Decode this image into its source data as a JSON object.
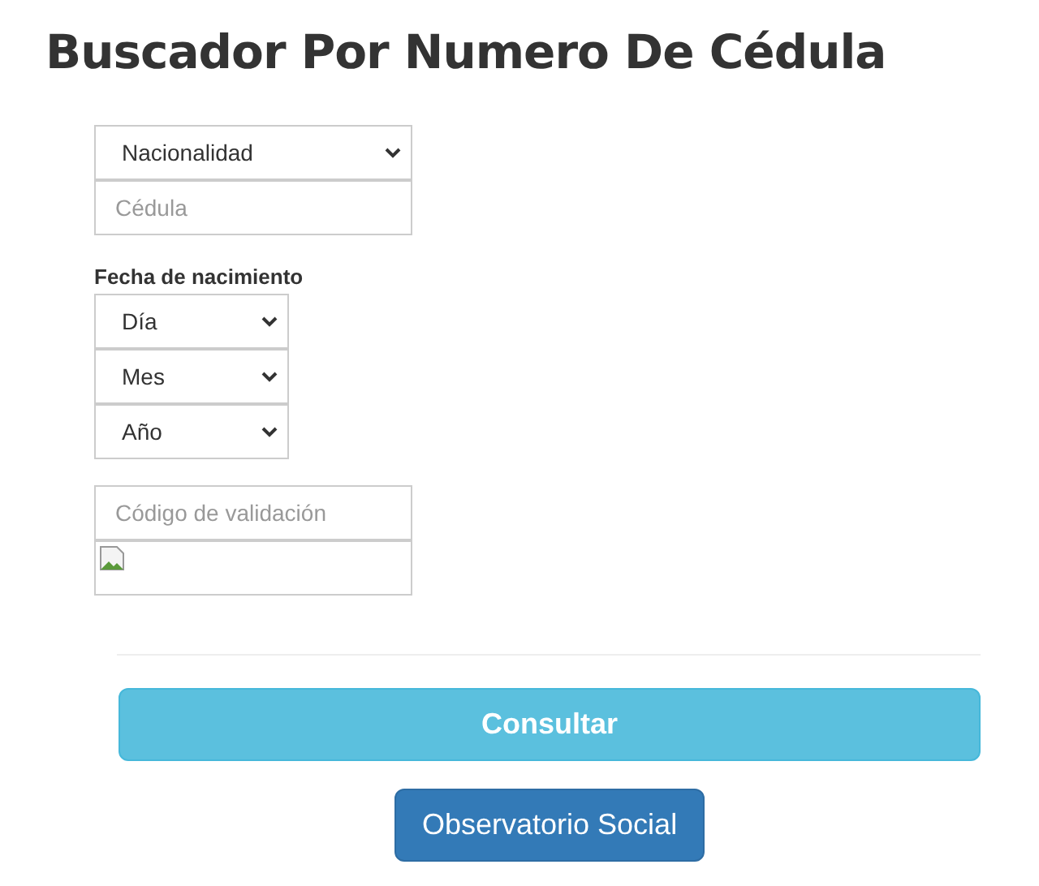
{
  "title": "Buscador Por Numero De Cédula",
  "nationality_select": {
    "value": "Nacionalidad"
  },
  "id_field": {
    "placeholder": "Cédula"
  },
  "birth_date": {
    "label": "Fecha de nacimiento",
    "selects": [
      {
        "value": "Día"
      },
      {
        "value": "Mes"
      },
      {
        "value": "Año"
      }
    ]
  },
  "validation_field": {
    "placeholder": "Código de validación"
  },
  "submit_button": "Consultar",
  "link_button": "Observatorio Social"
}
